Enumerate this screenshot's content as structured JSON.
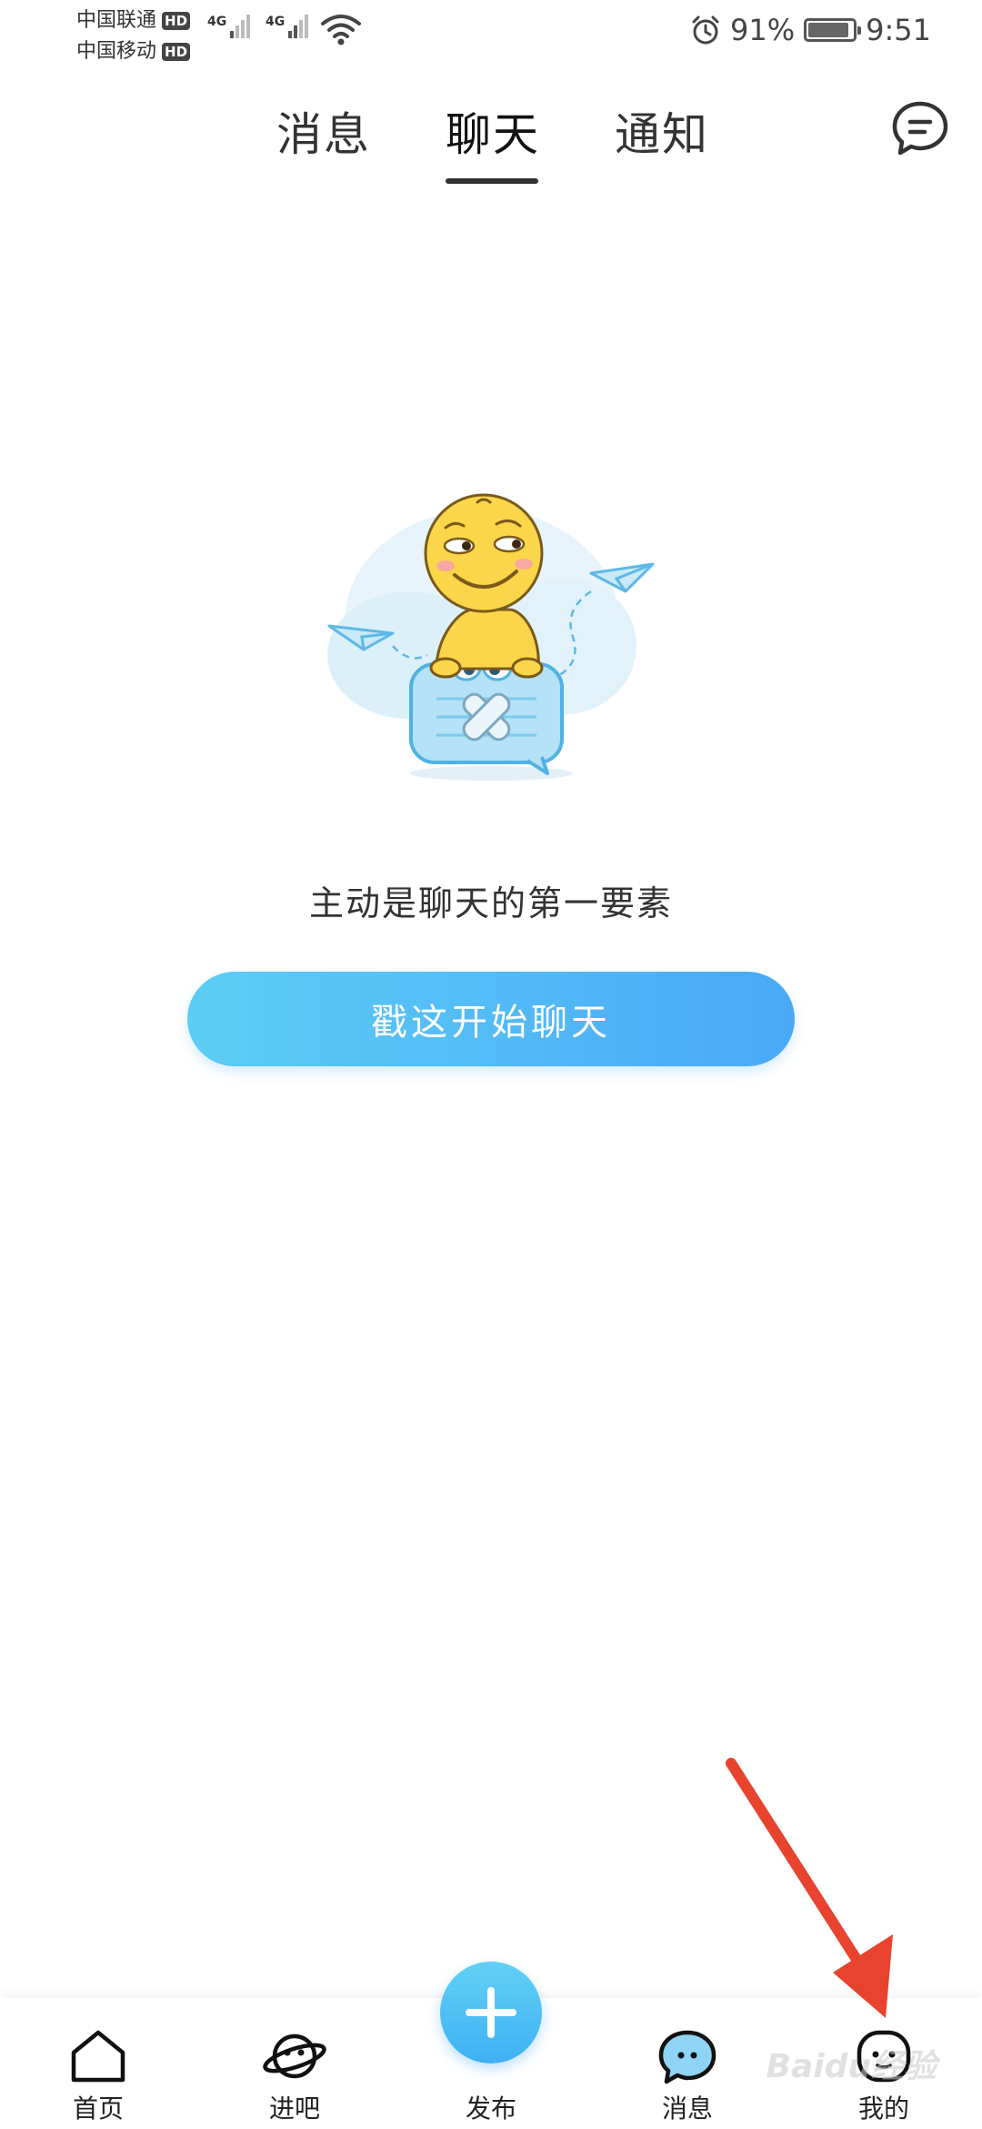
{
  "status_bar": {
    "carrier_1": "中国联通",
    "carrier_2": "中国移动",
    "hd_badge": "HD",
    "network_1": "4G",
    "network_2": "4G",
    "battery_percent": "91%",
    "battery_level": 0.91,
    "time": "9:51"
  },
  "tabs": {
    "items": [
      {
        "label": "消息",
        "active": false
      },
      {
        "label": "聊天",
        "active": true
      },
      {
        "label": "通知",
        "active": false
      }
    ]
  },
  "empty_state": {
    "message": "主动是聊天的第一要素",
    "button_label": "戳这开始聊天"
  },
  "bottom_nav": {
    "items": [
      {
        "label": "首页",
        "icon": "home-icon"
      },
      {
        "label": "进吧",
        "icon": "planet-icon"
      },
      {
        "label": "发布",
        "icon": "plus-icon"
      },
      {
        "label": "消息",
        "icon": "chat-bubble-icon"
      },
      {
        "label": "我的",
        "icon": "profile-face-icon"
      }
    ]
  },
  "watermark": "Baidu经验",
  "colors": {
    "accent_start": "#5ccdf6",
    "accent_end": "#4aa9f6",
    "annotation_arrow": "#e8432e"
  }
}
